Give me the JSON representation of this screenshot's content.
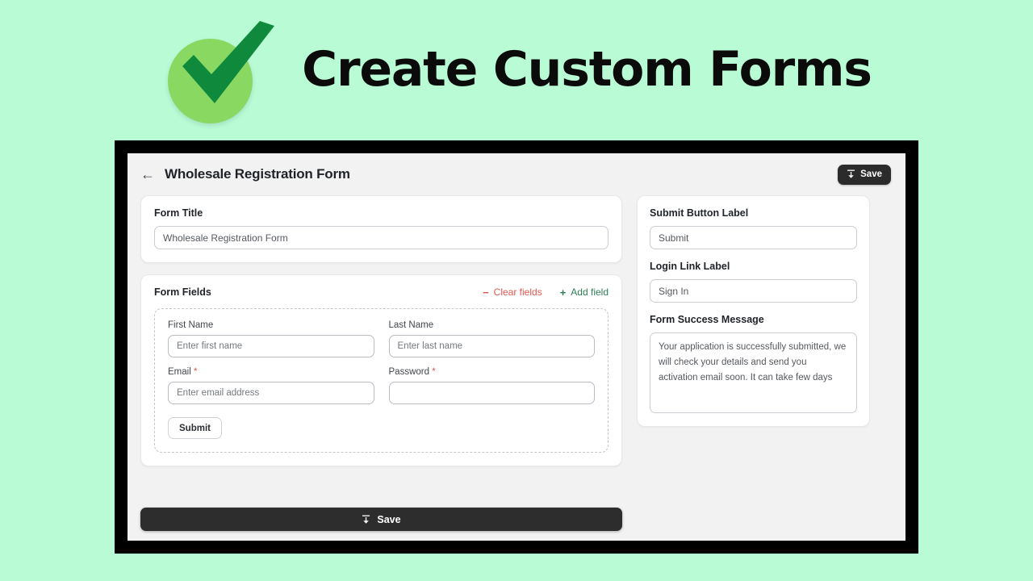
{
  "hero": {
    "title": "Create Custom Forms",
    "badge_icon": "green-check-badge-icon",
    "background_color": "#b8fbd5",
    "circle_color": "#88d862",
    "check_color": "#0f8a3d"
  },
  "app": {
    "header": {
      "back_icon": "back-arrow-icon",
      "title": "Wholesale Registration Form",
      "save_label": "Save",
      "save_icon": "save-download-icon"
    },
    "form_title_card": {
      "label": "Form Title",
      "value": "Wholesale Registration Form",
      "placeholder": "Wholesale Registration Form"
    },
    "form_fields_card": {
      "label": "Form Fields",
      "clear_label": "Clear fields",
      "clear_icon": "minus-icon",
      "clear_color": "#e0564f",
      "add_label": "Add field",
      "add_icon": "plus-icon",
      "add_color": "#2e7d55",
      "fields": [
        {
          "label": "First Name",
          "required": false,
          "placeholder": "Enter first name",
          "value": ""
        },
        {
          "label": "Last Name",
          "required": false,
          "placeholder": "Enter last name",
          "value": ""
        },
        {
          "label": "Email",
          "required": true,
          "placeholder": "Enter email address",
          "value": ""
        },
        {
          "label": "Password",
          "required": true,
          "placeholder": "",
          "value": ""
        }
      ],
      "preview_submit_label": "Submit"
    },
    "settings_card": {
      "submit_button_label_title": "Submit Button Label",
      "submit_button_value": "Submit",
      "login_link_label_title": "Login Link Label",
      "login_link_value": "Sign In",
      "success_message_title": "Form Success Message",
      "success_message_value": "Your application is successfully submitted, we will check your details and send you activation email soon. It can take few days"
    },
    "footer": {
      "save_label": "Save",
      "save_icon": "save-download-icon"
    }
  }
}
